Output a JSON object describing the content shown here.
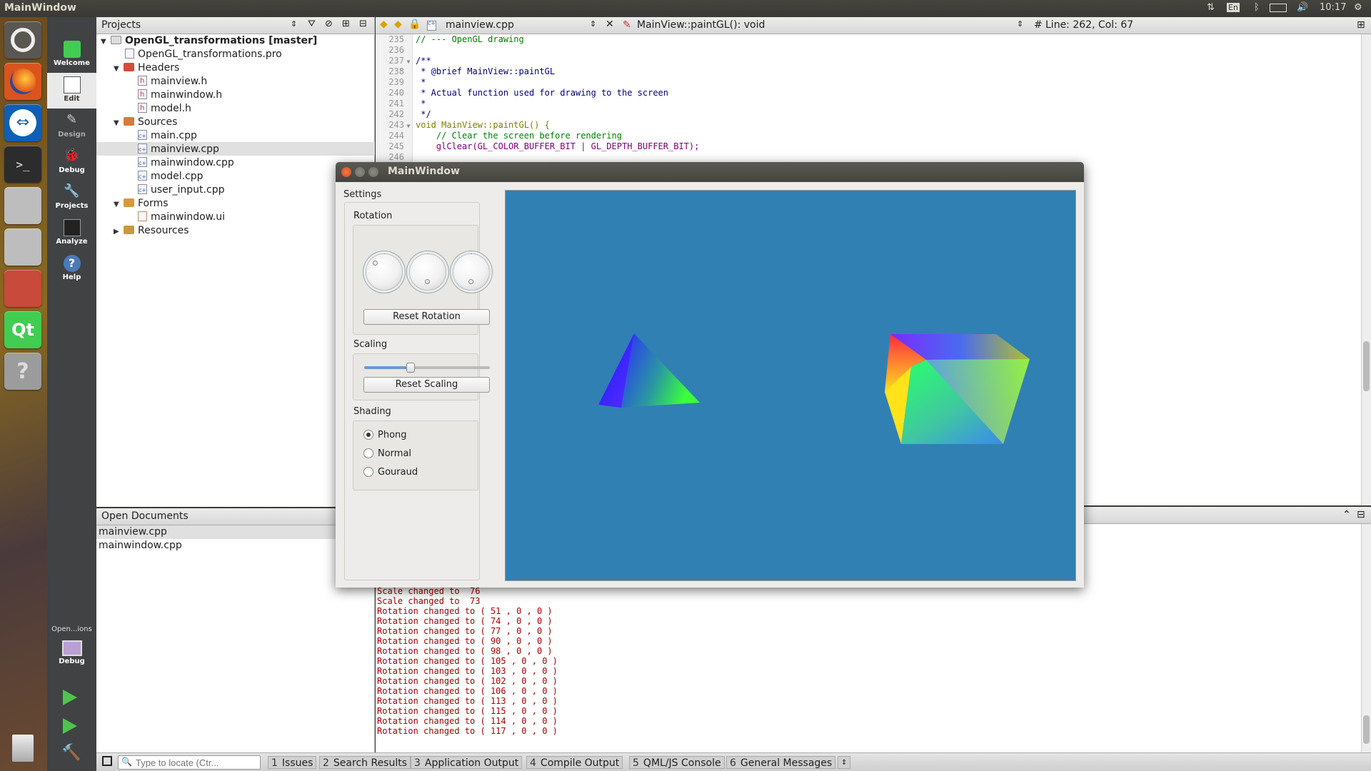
{
  "topbar": {
    "window_title": "MainWindow",
    "lang": "En",
    "time": "10:17"
  },
  "modes": [
    "Welcome",
    "Edit",
    "Design",
    "Debug",
    "Projects",
    "Analyze",
    "Help"
  ],
  "kit": {
    "label": "Open...ions",
    "mode": "Debug"
  },
  "projects": {
    "title": "Projects",
    "root": "OpenGL_transformations [master]",
    "pro": "OpenGL_transformations.pro",
    "headers_label": "Headers",
    "headers": [
      "mainview.h",
      "mainwindow.h",
      "model.h"
    ],
    "sources_label": "Sources",
    "sources": [
      "main.cpp",
      "mainview.cpp",
      "mainwindow.cpp",
      "model.cpp",
      "user_input.cpp"
    ],
    "forms_label": "Forms",
    "forms": [
      "mainwindow.ui"
    ],
    "resources_label": "Resources"
  },
  "open_docs": {
    "title": "Open Documents",
    "items": [
      "mainview.cpp",
      "mainwindow.cpp"
    ]
  },
  "editor": {
    "file": "mainview.cpp",
    "symbol": "MainView::paintGL(): void",
    "position": "Line: 262, Col: 67",
    "lines": [
      {
        "n": "235",
        "t": "// --- OpenGL drawing"
      },
      {
        "n": "236",
        "t": ""
      },
      {
        "n": "237",
        "t": "/**"
      },
      {
        "n": "238",
        "t": " * @brief MainView::paintGL"
      },
      {
        "n": "239",
        "t": " *"
      },
      {
        "n": "240",
        "t": " * Actual function used for drawing to the screen"
      },
      {
        "n": "241",
        "t": " *"
      },
      {
        "n": "242",
        "t": " */"
      },
      {
        "n": "243",
        "t": "void MainView::paintGL() {"
      },
      {
        "n": "244",
        "t": "    // Clear the screen before rendering"
      },
      {
        "n": "245",
        "t": "    glClear(GL_COLOR_BUFFER_BIT | GL_DEPTH_BUFFER_BIT);"
      },
      {
        "n": "246",
        "t": ""
      }
    ]
  },
  "output_lines": [
    "Scale changed to  76",
    "Scale changed to  73",
    "Rotation changed to ( 51 , 0 , 0 )",
    "Rotation changed to ( 74 , 0 , 0 )",
    "Rotation changed to ( 77 , 0 , 0 )",
    "Rotation changed to ( 90 , 0 , 0 )",
    "Rotation changed to ( 98 , 0 , 0 )",
    "Rotation changed to ( 105 , 0 , 0 )",
    "Rotation changed to ( 103 , 0 , 0 )",
    "Rotation changed to ( 102 , 0 , 0 )",
    "Rotation changed to ( 106 , 0 , 0 )",
    "Rotation changed to ( 113 , 0 , 0 )",
    "Rotation changed to ( 115 , 0 , 0 )",
    "Rotation changed to ( 114 , 0 , 0 )",
    "Rotation changed to ( 117 , 0 , 0 )"
  ],
  "statusbar": {
    "locator_placeholder": "Type to locate (Ctr...",
    "tabs": [
      {
        "num": "1",
        "label": "Issues"
      },
      {
        "num": "2",
        "label": "Search Results"
      },
      {
        "num": "3",
        "label": "Application Output"
      },
      {
        "num": "4",
        "label": "Compile Output"
      },
      {
        "num": "5",
        "label": "QML/JS Console"
      },
      {
        "num": "6",
        "label": "General Messages"
      }
    ]
  },
  "app": {
    "title": "MainWindow",
    "settings_label": "Settings",
    "rotation_label": "Rotation",
    "reset_rotation": "Reset Rotation",
    "scaling_label": "Scaling",
    "scaling_value": 0.37,
    "reset_scaling": "Reset Scaling",
    "shading_label": "Shading",
    "shading_options": [
      "Phong",
      "Normal",
      "Gouraud"
    ],
    "shading_selected": "Phong",
    "gl_background": "#3180b4"
  }
}
